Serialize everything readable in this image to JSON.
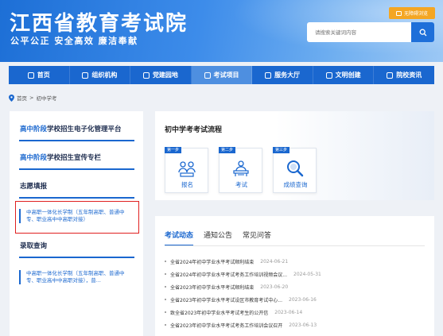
{
  "header": {
    "title": "江西省教育考试院",
    "slogan": "公平公正  安全高效  廉洁奉献",
    "barrier_label": "无障碍浏览",
    "search_placeholder": "请搜索关键词内容"
  },
  "nav": {
    "items": [
      {
        "label": "首页",
        "icon": "home-icon"
      },
      {
        "label": "组织机构",
        "icon": "org-icon"
      },
      {
        "label": "党建园地",
        "icon": "party-icon"
      },
      {
        "label": "考试项目",
        "icon": "exam-icon",
        "active": true
      },
      {
        "label": "服务大厅",
        "icon": "service-icon"
      },
      {
        "label": "文明创建",
        "icon": "civil-icon"
      },
      {
        "label": "院校资讯",
        "icon": "school-icon"
      }
    ]
  },
  "breadcrumb": {
    "home": "首页",
    "separator": ">",
    "current": "初中学考"
  },
  "left": {
    "link1_hl": "高中阶段",
    "link1_rest": "学校招生电子化管理平台",
    "link2_hl": "高中阶段",
    "link2_rest": "学校招生宣传专栏",
    "section1": "志愿填报",
    "section1_item": "中高职一体化长学制（五年制高职、普通中专、职业高中中高职对接）",
    "section2": "录取查询",
    "section2_item": "中高职一体化长学制（五年制高职、普通中专、职业高中中高职对接），普..."
  },
  "flow": {
    "title": "初中学考考试流程",
    "steps": [
      {
        "tag": "第一步",
        "label": "报名",
        "icon": "people-icon"
      },
      {
        "tag": "第二步",
        "label": "考试",
        "icon": "exam-desk-icon"
      },
      {
        "tag": "第三步",
        "label": "成绩查询",
        "icon": "magnifier-icon"
      }
    ]
  },
  "news": {
    "tabs": [
      "考试动态",
      "通知公告",
      "常见问答"
    ],
    "items": [
      {
        "title": "全省2024年初中学业水平考试顺利结束",
        "date": "2024-06-21"
      },
      {
        "title": "全省2024年初中学业水平考试考务工作培训视频会议...",
        "date": "2024-05-31"
      },
      {
        "title": "全省2023年初中学业水平考试顺利结束",
        "date": "2023-06-20"
      },
      {
        "title": "全省2023年初中学业水平考试设区市教育考试中心...",
        "date": "2023-06-16"
      },
      {
        "title": "致全省2023年初中学业水平考试考生的公开信",
        "date": "2023-06-14"
      },
      {
        "title": "全省2023年初中学业水平考试考务工作培训会议召开",
        "date": "2023-06-13"
      }
    ]
  },
  "colors": {
    "brand": "#1a67cf",
    "accent": "#f4a623",
    "highlight_border": "#e02020"
  }
}
